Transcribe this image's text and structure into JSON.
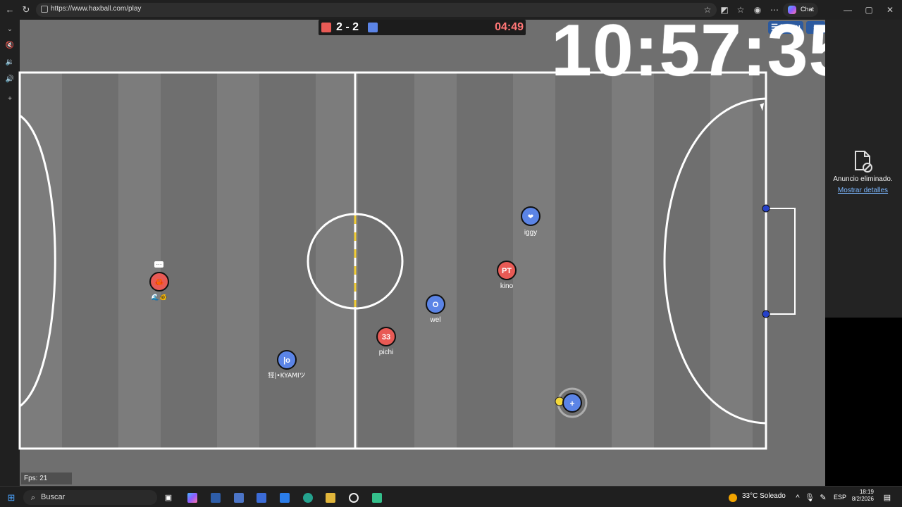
{
  "browser": {
    "url": "https://www.haxball.com/play",
    "chat_label": "Chat",
    "icons": [
      "back-icon",
      "refresh-icon",
      "star-icon",
      "extensions-icon",
      "favorites-icon",
      "profile-icon",
      "more-icon",
      "minimize-icon",
      "maximize-icon",
      "close-icon"
    ]
  },
  "game": {
    "score": "2 - 2",
    "timer": "04:49",
    "menu_label": "☰ Menu",
    "overlay_clock": "10:57:35",
    "fps": "Fps: 21",
    "players": [
      {
        "id": "iggy",
        "name": "iggy",
        "avatar": "❤",
        "team": "blue"
      },
      {
        "id": "kino",
        "name": "kino",
        "avatar": "PT",
        "team": "red"
      },
      {
        "id": "wel",
        "name": "wel",
        "avatar": "O",
        "team": "blue"
      },
      {
        "id": "pichi",
        "name": "pichi",
        "avatar": "33",
        "team": "red"
      },
      {
        "id": "kyami",
        "name": "㹵|•KYAMIツ",
        "avatar": "|o",
        "team": "blue"
      },
      {
        "id": "controlled",
        "name": "",
        "avatar": "+",
        "team": "blue"
      },
      {
        "id": "left-red",
        "name": "🌊🐠",
        "avatar": "🦀",
        "team": "red"
      }
    ],
    "colors": {
      "red": "#e85a55",
      "blue": "#5b84e6",
      "field": "#6f6f6f",
      "ball": "#f4d83a"
    }
  },
  "ad": {
    "text": "Anuncio eliminado.",
    "link": "Mostrar detalles"
  },
  "taskbar": {
    "search": "Buscar",
    "weather": "33°C  Soleado",
    "language": "ESP",
    "time": "18:19",
    "date": "8/2/2026"
  }
}
